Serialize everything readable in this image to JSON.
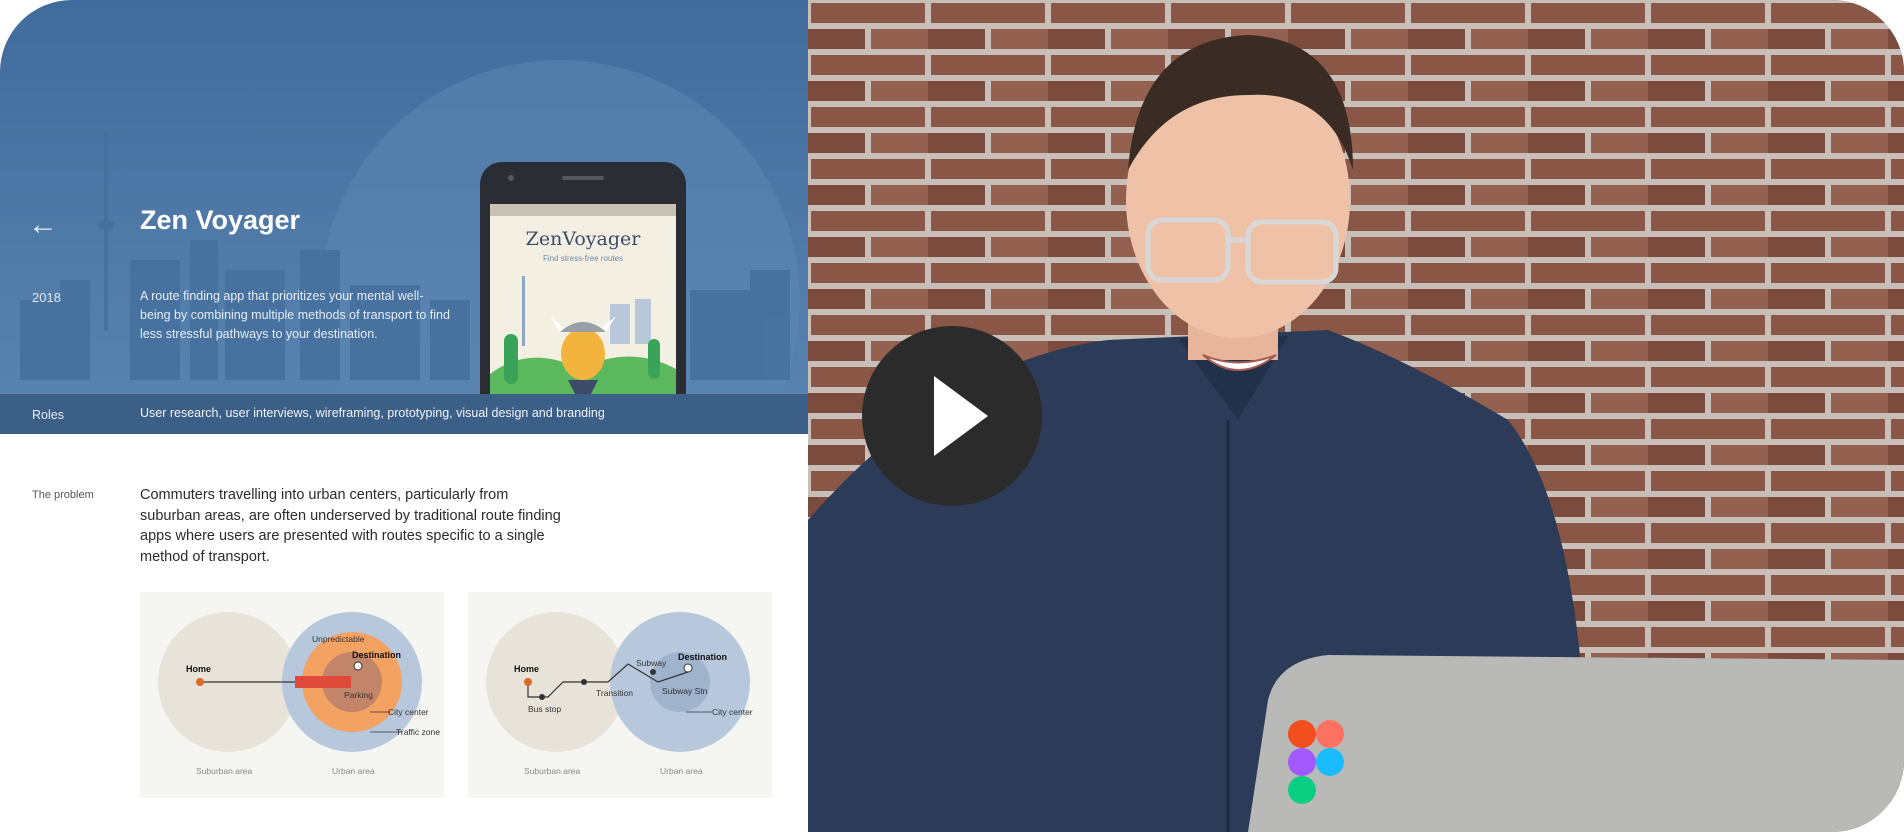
{
  "case_study": {
    "back_icon": "arrow-left-icon",
    "title": "Zen Voyager",
    "year": "2018",
    "description": "A route finding app that prioritizes your mental well-being by combining multiple methods of transport to find less stressful pathways to your destination.",
    "roles_label": "Roles",
    "roles_text": "User research, user interviews, wireframing, prototyping, visual design and branding",
    "phone": {
      "app_title": "ZenVoyager",
      "app_subtitle": "Find stress-free routes"
    },
    "problem_label": "The problem",
    "problem_text": "Commuters travelling into urban centers, particularly from suburban areas, are often underserved by traditional route finding apps where users are presented with routes specific to a single method of transport."
  },
  "diagrams": {
    "left": {
      "home": "Home",
      "destination": "Destination",
      "unpredictable": "Unpredictable",
      "parking": "Parking",
      "city_center": "City center",
      "traffic_zone": "Traffic zone",
      "suburban": "Suburban area",
      "urban": "Urban area"
    },
    "right": {
      "home": "Home",
      "destination": "Destination",
      "bus_stop": "Bus stop",
      "subway": "Subway",
      "transition": "Transition",
      "subway_stn": "Subway Stn",
      "city_center": "City center",
      "suburban": "Suburban area",
      "urban": "Urban area"
    }
  },
  "video": {
    "play_icon": "play-icon",
    "figma_logo": "figma-logo-icon"
  },
  "colors": {
    "hero_blue": "#4f7aa8",
    "roles_bar": "#3c5f87",
    "play_button": "#2b2b2b",
    "shirt": "#2c3b57",
    "brick": "#8a5746"
  }
}
